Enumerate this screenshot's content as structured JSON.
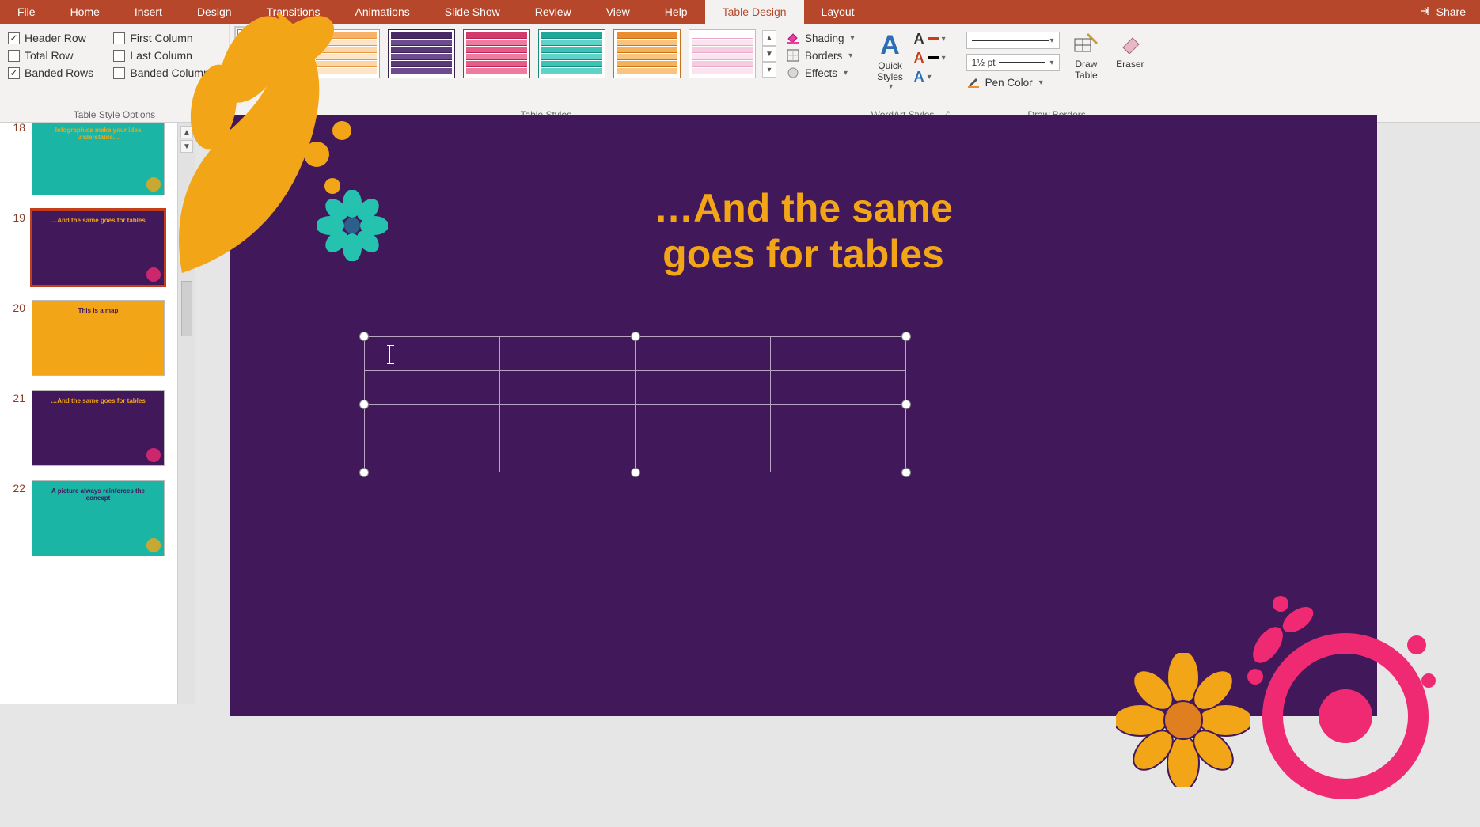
{
  "menubar": {
    "tabs": [
      "File",
      "Home",
      "Insert",
      "Design",
      "Transitions",
      "Animations",
      "Slide Show",
      "Review",
      "View",
      "Help",
      "Table Design",
      "Layout"
    ],
    "active_index": 10,
    "share": "Share"
  },
  "ribbon": {
    "groups": {
      "table_style_options": {
        "label": "Table Style Options",
        "options": [
          {
            "label": "Header Row",
            "checked": true
          },
          {
            "label": "First Column",
            "checked": false
          },
          {
            "label": "Total Row",
            "checked": false
          },
          {
            "label": "Last Column",
            "checked": false
          },
          {
            "label": "Banded Rows",
            "checked": true
          },
          {
            "label": "Banded Columns",
            "checked": false
          }
        ]
      },
      "table_styles": {
        "label": "Table Styles",
        "swatches": [
          {
            "name": "no-style-grid",
            "header": "#ffffff",
            "row1": "#ffffff",
            "row2": "#f2f2f2",
            "border": "#808080",
            "selected": true
          },
          {
            "name": "light-orange",
            "header": "#f7b267",
            "row1": "#fde5c9",
            "row2": "#fbd6a8",
            "border": "#e8953e"
          },
          {
            "name": "medium-purple",
            "header": "#4a2a66",
            "row1": "#6e4a8e",
            "row2": "#5a3a78",
            "border": "#3a2250"
          },
          {
            "name": "medium-pink",
            "header": "#d23a6b",
            "row1": "#f07ba0",
            "row2": "#e75b87",
            "border": "#b52556"
          },
          {
            "name": "medium-teal",
            "header": "#1fa79a",
            "row1": "#5fd3c7",
            "row2": "#3bc3b5",
            "border": "#158a7f"
          },
          {
            "name": "medium-orange",
            "header": "#e98e2e",
            "row1": "#f8c47e",
            "row2": "#f3b15a",
            "border": "#c8721b"
          },
          {
            "name": "light-pink",
            "header": "#ffffff",
            "row1": "#fbe4ef",
            "row2": "#f6cde0",
            "border": "#e7a8c5"
          }
        ],
        "shading": "Shading",
        "borders": "Borders",
        "effects": "Effects"
      },
      "wordart_styles": {
        "label": "WordArt Styles",
        "quick_styles": "Quick Styles",
        "fill_color": "#c43e1c",
        "outline_color": "#000000",
        "effects_color": "#2a6fb5"
      },
      "draw_borders": {
        "label": "Draw Borders",
        "pen_weight": "1½ pt",
        "pen_color": "Pen Color",
        "pen_color_swatch": "#e98e2e",
        "draw_table": "Draw Table",
        "eraser": "Eraser"
      }
    }
  },
  "thumbnails": {
    "items": [
      {
        "num": "18",
        "bg": "#1ab5a5",
        "title": "Infographics make your idea understable…",
        "title_color": "#f2a516"
      },
      {
        "num": "19",
        "bg": "#41185a",
        "title": "…And the same goes for tables",
        "title_color": "#f2a516",
        "selected": true
      },
      {
        "num": "20",
        "bg": "#f2a516",
        "title": "This is a map",
        "title_color": "#41185a"
      },
      {
        "num": "21",
        "bg": "#41185a",
        "title": "…And the same goes for tables",
        "title_color": "#f2a516"
      },
      {
        "num": "22",
        "bg": "#1ab5a5",
        "title": "A picture always reinforces the concept",
        "title_color": "#41185a"
      }
    ]
  },
  "slide": {
    "title_line1": "…And the same",
    "title_line2": "goes for tables",
    "table": {
      "rows": 4,
      "cols": 4
    }
  },
  "colors": {
    "accent": "#b7472a",
    "slide_bg": "#41185a",
    "slide_accent": "#f2a516",
    "pink": "#ef2a72",
    "teal": "#26c2b0"
  }
}
